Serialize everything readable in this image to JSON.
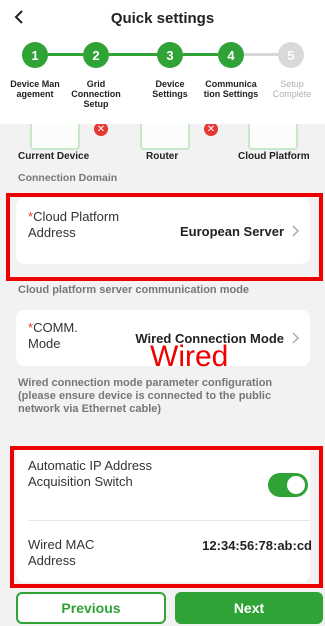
{
  "header": {
    "title": "Quick settings",
    "back_icon": "chevron-left-icon"
  },
  "stepper": {
    "steps": [
      {
        "number": "1",
        "label": "Device Man agement",
        "state": "done"
      },
      {
        "number": "2",
        "label": "Grid Connection Setup",
        "state": "done"
      },
      {
        "number": "3",
        "label": "Device Settings",
        "state": "done"
      },
      {
        "number": "4",
        "label": "Communica tion Settings",
        "state": "current"
      },
      {
        "number": "5",
        "label": "Setup Complete",
        "state": "pending"
      }
    ]
  },
  "diagram": {
    "labels": [
      "Current Device",
      "Router",
      "Cloud Platform"
    ],
    "status_icon": "error-x-icon"
  },
  "connection_domain": {
    "title": "Connection Domain",
    "cloud_address": {
      "required_mark": "*",
      "label": "Cloud Platform Address",
      "value": "European Server"
    }
  },
  "comm_mode_section": {
    "title": "Cloud platform server communication mode",
    "mode": {
      "required_mark": "*",
      "label": "COMM. Mode",
      "value": "Wired Connection Mode"
    },
    "annotation": "Wired",
    "hint": "Wired connection mode parameter configuration (please ensure device is connected to the public network via Ethernet cable)"
  },
  "wired_settings": {
    "auto_ip": {
      "label": "Automatic IP Address Acquisition Switch",
      "enabled": true
    },
    "mac": {
      "label": "Wired MAC Address",
      "value": "12:34:56:78:ab:cd"
    }
  },
  "footer": {
    "previous_label": "Previous",
    "next_label": "Next"
  },
  "colors": {
    "accent": "#2fa336",
    "highlight": "#ee0000",
    "required": "#e53935"
  }
}
